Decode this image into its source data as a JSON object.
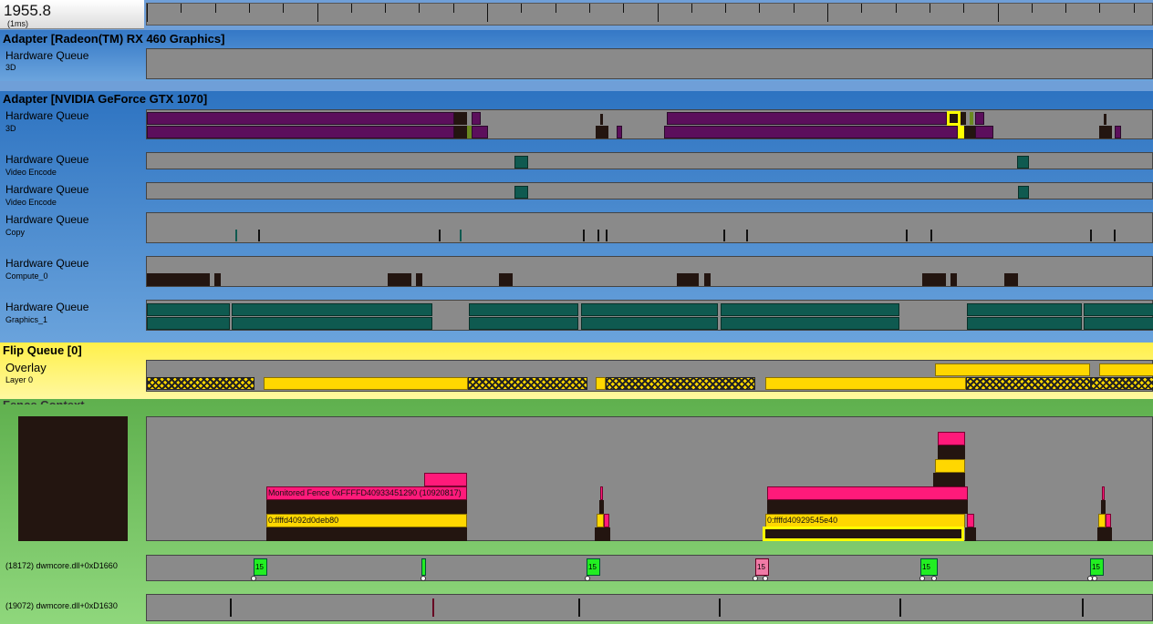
{
  "ruler": {
    "time": "1955.8",
    "unit": "(1ms)"
  },
  "adapters": [
    {
      "title": "Adapter [Radeon(TM) RX 460 Graphics]",
      "queues": [
        {
          "label": "Hardware Queue",
          "sub": "3D"
        }
      ]
    },
    {
      "title": "Adapter [NVIDIA GeForce GTX 1070]",
      "queues": [
        {
          "label": "Hardware Queue",
          "sub": "3D"
        },
        {
          "label": "Hardware Queue",
          "sub": "Video Encode"
        },
        {
          "label": "Hardware Queue",
          "sub": "Video Encode"
        },
        {
          "label": "Hardware Queue",
          "sub": "Copy"
        },
        {
          "label": "Hardware Queue",
          "sub": "Compute_0"
        },
        {
          "label": "Hardware Queue",
          "sub": "Graphics_1"
        }
      ]
    }
  ],
  "flip": {
    "title": "Flip Queue [0]",
    "label": "Overlay",
    "sub": "Layer 0"
  },
  "fence": {
    "title": "Fence Context",
    "blocks": {
      "monitored": "Monitored Fence 0xFFFFD40933451290 (10920817)",
      "addr1": "0:ffffd4092d0deb80",
      "addr2": "0:ffffd40929545e40"
    }
  },
  "threads": [
    {
      "label": "(18172) dwmcore.dll+0xD1660",
      "markers": [
        "15",
        "",
        "15",
        "15",
        "15",
        "15"
      ]
    },
    {
      "label": "(19072) dwmcore.dll+0xD1630"
    }
  ],
  "colors": {
    "adapter_band": "#2f78c4",
    "flip_band": "#ffee55",
    "fence_band": "#63b652",
    "purple": "#5c0f5c",
    "teal": "#0f5a50",
    "yellow": "#ffd700",
    "pink": "#ff1a7a",
    "green_marker": "#22ee22"
  }
}
